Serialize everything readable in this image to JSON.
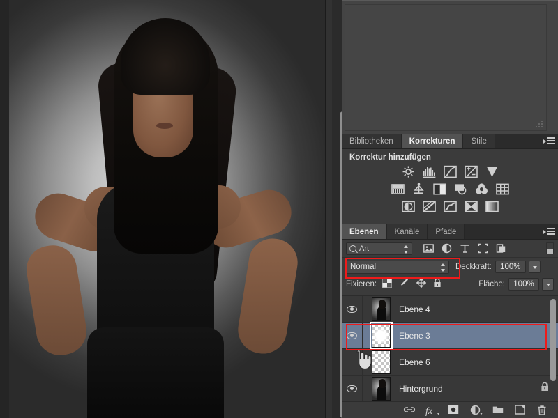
{
  "app": {
    "name": "Adobe Photoshop",
    "language": "de"
  },
  "canvas": {
    "document_name": "",
    "subject_description": "Woman with long dark hair, hands on hips, gray studio backdrop"
  },
  "adjustments_panel": {
    "tabs": [
      {
        "label": "Bibliotheken",
        "active": false
      },
      {
        "label": "Korrekturen",
        "active": true
      },
      {
        "label": "Stile",
        "active": false
      }
    ],
    "title": "Korrektur hinzufügen",
    "menu_icon": "panel-menu-icon",
    "rows": [
      [
        {
          "name": "brightness-contrast-icon",
          "label": "Helligkeit/Kontrast"
        },
        {
          "name": "levels-icon",
          "label": "Tonwertkorrektur"
        },
        {
          "name": "curves-icon",
          "label": "Gradationskurven"
        },
        {
          "name": "exposure-icon",
          "label": "Belichtung"
        },
        {
          "name": "vibrance-icon",
          "label": "Dynamik"
        }
      ],
      [
        {
          "name": "hue-saturation-icon",
          "label": "Farbton/Sättigung"
        },
        {
          "name": "color-balance-icon",
          "label": "Farbbalance"
        },
        {
          "name": "black-white-icon",
          "label": "Schwarzweiß"
        },
        {
          "name": "photo-filter-icon",
          "label": "Fotofilter"
        },
        {
          "name": "channel-mixer-icon",
          "label": "Kanalmixer"
        },
        {
          "name": "color-lookup-icon",
          "label": "Color Lookup"
        }
      ],
      [
        {
          "name": "invert-icon",
          "label": "Umkehren"
        },
        {
          "name": "posterize-icon",
          "label": "Tontrennung"
        },
        {
          "name": "threshold-icon",
          "label": "Schwellenwert"
        },
        {
          "name": "selective-color-icon",
          "label": "Selektive Farbkorrektur"
        },
        {
          "name": "gradient-map-icon",
          "label": "Verlaufsumsetzung"
        }
      ]
    ]
  },
  "layers_panel": {
    "tabs": [
      {
        "label": "Ebenen",
        "active": true
      },
      {
        "label": "Kanäle",
        "active": false
      },
      {
        "label": "Pfade",
        "active": false
      }
    ],
    "menu_icon": "panel-menu-icon",
    "filter": {
      "kind_value": "Art",
      "search_icon": "search-icon",
      "type_filters": [
        {
          "name": "filter-pixel-icon"
        },
        {
          "name": "filter-adjustment-icon"
        },
        {
          "name": "filter-type-icon"
        },
        {
          "name": "filter-shape-icon"
        },
        {
          "name": "filter-smartobject-icon"
        }
      ],
      "toggle_name": "filter-enable-toggle"
    },
    "blend": {
      "mode_value": "Normal",
      "opacity_label": "Deckkraft:",
      "opacity_value": "100%",
      "fill_label": "Fläche:",
      "fill_value": "100%"
    },
    "lock": {
      "label": "Fixieren:",
      "icons": [
        {
          "name": "lock-transparency-icon"
        },
        {
          "name": "lock-image-icon"
        },
        {
          "name": "lock-position-icon"
        },
        {
          "name": "lock-all-icon"
        }
      ]
    },
    "layers": [
      {
        "name": "Ebene 4",
        "visible": true,
        "selected": false,
        "locked": false,
        "thumb": "photo"
      },
      {
        "name": "Ebene 3",
        "visible": true,
        "selected": true,
        "locked": false,
        "thumb": "glow"
      },
      {
        "name": "Ebene 6",
        "visible": false,
        "selected": false,
        "locked": false,
        "thumb": "empty"
      },
      {
        "name": "Hintergrund",
        "visible": true,
        "selected": false,
        "locked": true,
        "thumb": "photo"
      }
    ],
    "bottom_bar": [
      {
        "name": "link-layers-icon"
      },
      {
        "name": "layer-style-fx-icon",
        "label": "fx"
      },
      {
        "name": "add-layer-mask-icon"
      },
      {
        "name": "new-adjustment-layer-icon"
      },
      {
        "name": "new-group-icon"
      },
      {
        "name": "new-layer-icon"
      },
      {
        "name": "delete-layer-icon"
      }
    ]
  },
  "annotations": {
    "accent_color": "#ee1b1b",
    "highlighted": [
      "blend-mode-dropdown",
      "layer-row-ebene-3"
    ]
  }
}
